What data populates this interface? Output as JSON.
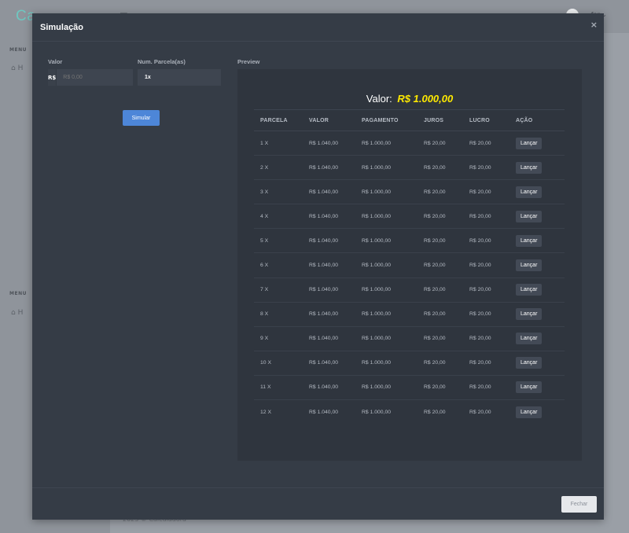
{
  "background": {
    "logo": "Ca",
    "user_name": "fer",
    "menu_label": "MENU",
    "home_label": "H",
    "footer": "2023 © Calculadora"
  },
  "modal": {
    "title": "Simulação",
    "close_icon": "×",
    "valor_label": "Valor",
    "valor_prefix": "R$",
    "valor_placeholder": "R$ 0,00",
    "parcelas_label": "Num. Parcela(as)",
    "parcelas_value": "1x",
    "simular_label": "Simular",
    "preview_label": "Preview",
    "preview_heading_label": "Valor:",
    "preview_heading_amount": "R$ 1.000,00",
    "fechar_label": "Fechar"
  },
  "table": {
    "headers": [
      "PARCELA",
      "VALOR",
      "PAGAMENTO",
      "JUROS",
      "LUCRO",
      "AÇÃO"
    ],
    "action_label": "Lançar",
    "rows": [
      {
        "parcela": "1 X",
        "valor": "R$ 1.040,00",
        "pagamento": "R$ 1.000,00",
        "juros": "R$ 20,00",
        "lucro": "R$ 20,00"
      },
      {
        "parcela": "2 X",
        "valor": "R$ 1.040,00",
        "pagamento": "R$ 1.000,00",
        "juros": "R$ 20,00",
        "lucro": "R$ 20,00"
      },
      {
        "parcela": "3 X",
        "valor": "R$ 1.040,00",
        "pagamento": "R$ 1.000,00",
        "juros": "R$ 20,00",
        "lucro": "R$ 20,00"
      },
      {
        "parcela": "4 X",
        "valor": "R$ 1.040,00",
        "pagamento": "R$ 1.000,00",
        "juros": "R$ 20,00",
        "lucro": "R$ 20,00"
      },
      {
        "parcela": "5 X",
        "valor": "R$ 1.040,00",
        "pagamento": "R$ 1.000,00",
        "juros": "R$ 20,00",
        "lucro": "R$ 20,00"
      },
      {
        "parcela": "6 X",
        "valor": "R$ 1.040,00",
        "pagamento": "R$ 1.000,00",
        "juros": "R$ 20,00",
        "lucro": "R$ 20,00"
      },
      {
        "parcela": "7 X",
        "valor": "R$ 1.040,00",
        "pagamento": "R$ 1.000,00",
        "juros": "R$ 20,00",
        "lucro": "R$ 20,00"
      },
      {
        "parcela": "8 X",
        "valor": "R$ 1.040,00",
        "pagamento": "R$ 1.000,00",
        "juros": "R$ 20,00",
        "lucro": "R$ 20,00"
      },
      {
        "parcela": "9 X",
        "valor": "R$ 1.040,00",
        "pagamento": "R$ 1.000,00",
        "juros": "R$ 20,00",
        "lucro": "R$ 20,00"
      },
      {
        "parcela": "10 X",
        "valor": "R$ 1.040,00",
        "pagamento": "R$ 1.000,00",
        "juros": "R$ 20,00",
        "lucro": "R$ 20,00"
      },
      {
        "parcela": "11 X",
        "valor": "R$ 1.040,00",
        "pagamento": "R$ 1.000,00",
        "juros": "R$ 20,00",
        "lucro": "R$ 20,00"
      },
      {
        "parcela": "12 X",
        "valor": "R$ 1.040,00",
        "pagamento": "R$ 1.000,00",
        "juros": "R$ 20,00",
        "lucro": "R$ 20,00"
      }
    ]
  }
}
